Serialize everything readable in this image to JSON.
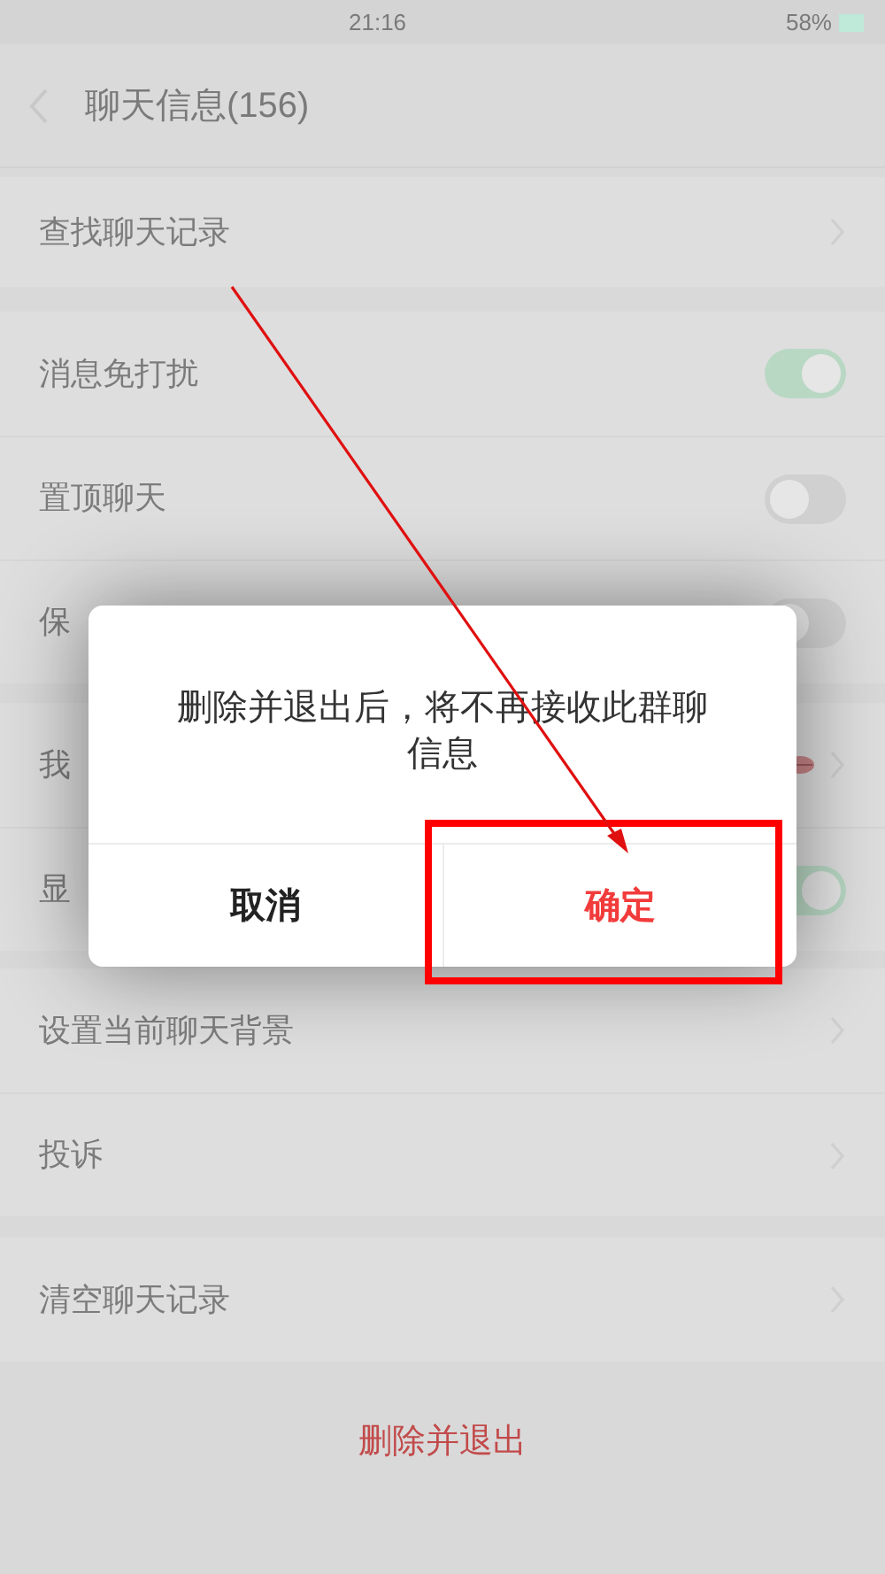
{
  "status_bar": {
    "time": "21:16",
    "battery": "58%"
  },
  "header": {
    "title": "聊天信息(156)"
  },
  "sections": [
    [
      {
        "label": "查找聊天记录",
        "kind": "link"
      }
    ],
    [
      {
        "label": "消息免打扰",
        "kind": "switch",
        "on": true
      },
      {
        "label": "置顶聊天",
        "kind": "switch",
        "on": false
      },
      {
        "label": "保",
        "kind": "switch",
        "on": false
      }
    ],
    [
      {
        "label": "我",
        "kind": "sticker"
      },
      {
        "label": "显",
        "kind": "switch",
        "on": true
      }
    ],
    [
      {
        "label": "设置当前聊天背景",
        "kind": "link"
      },
      {
        "label": "投诉",
        "kind": "link"
      }
    ],
    [
      {
        "label": "清空聊天记录",
        "kind": "link"
      }
    ]
  ],
  "exit_button": "删除并退出",
  "dialog": {
    "message": "删除并退出后，将不再接收此群聊信息",
    "buttons": [
      {
        "label": "取消",
        "kind": "cancel"
      },
      {
        "label": "确定",
        "kind": "confirm"
      }
    ]
  }
}
